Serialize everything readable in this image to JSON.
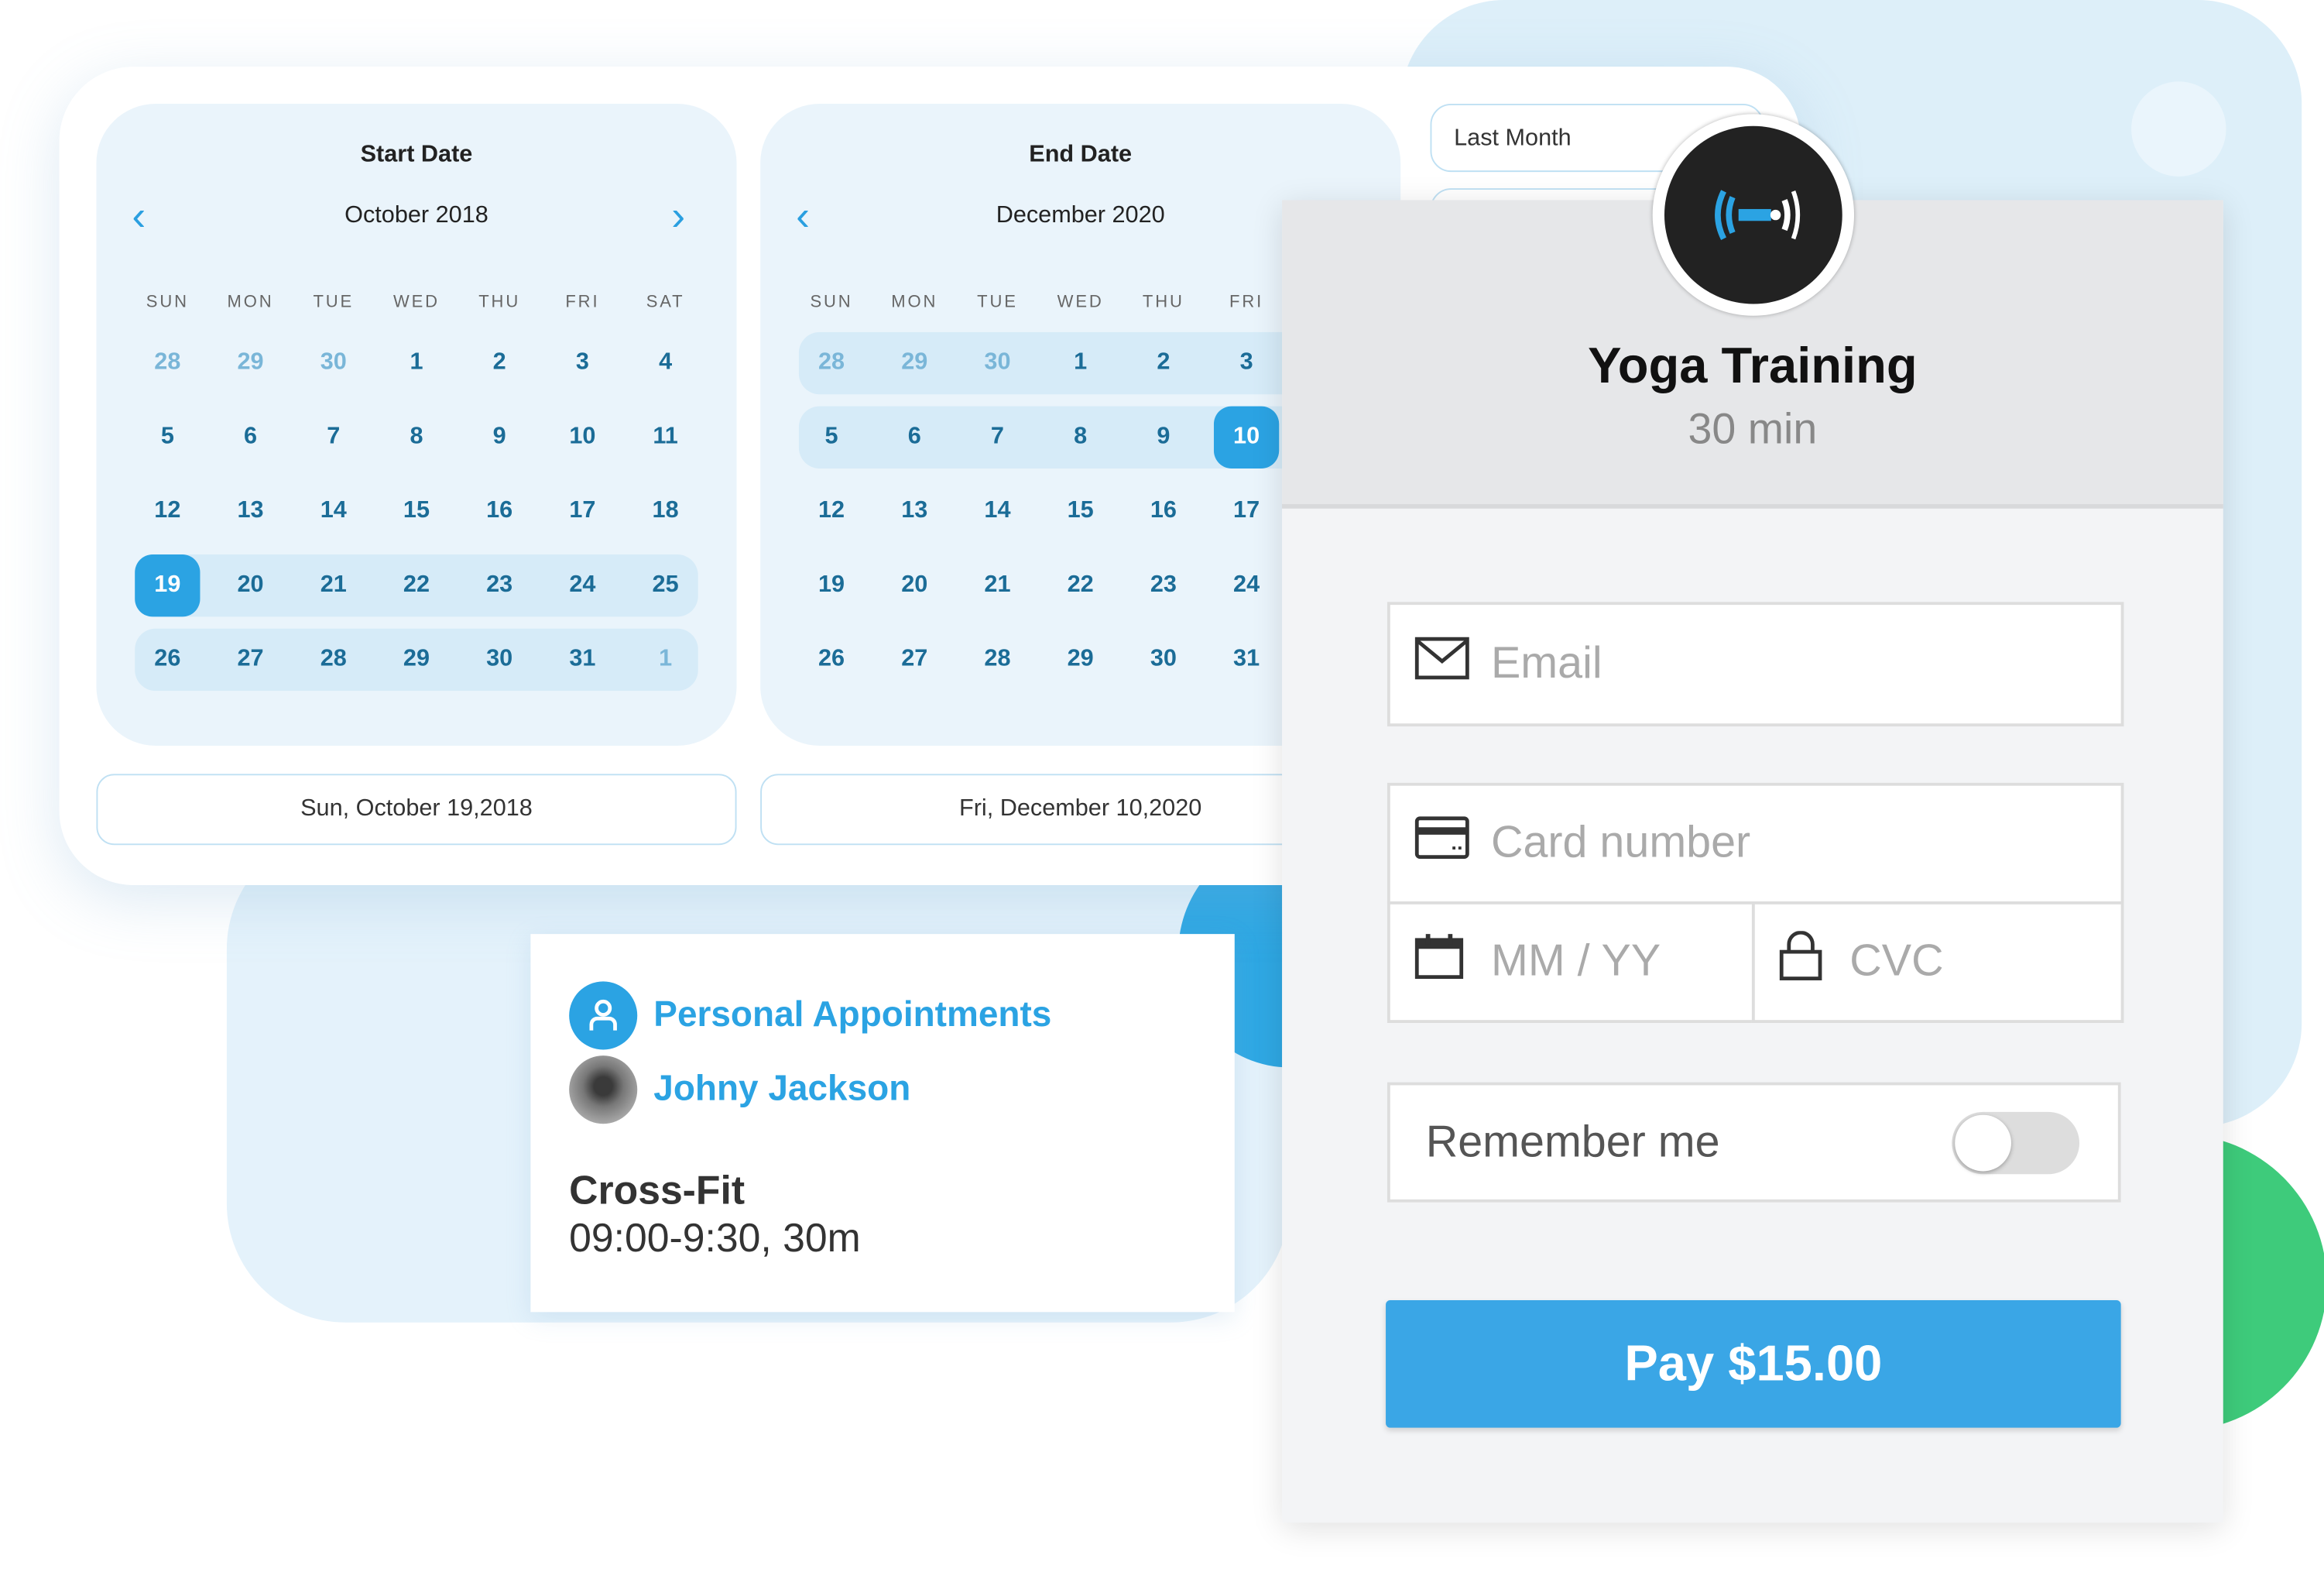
{
  "colors": {
    "accent": "#2ba3e3",
    "pay_button": "#3aa6e6",
    "green": "#3ecb7b",
    "range": "#d6ebf8"
  },
  "weekdays": [
    "SUN",
    "MON",
    "TUE",
    "WED",
    "THU",
    "FRI",
    "SAT"
  ],
  "start_calendar": {
    "title": "Start Date",
    "month": "October 2018",
    "prev_icon": "chevron-left-icon",
    "next_icon": "chevron-right-icon",
    "weeks": [
      [
        "28",
        "29",
        "30",
        "1",
        "2",
        "3",
        "4"
      ],
      [
        "5",
        "6",
        "7",
        "8",
        "9",
        "10",
        "11"
      ],
      [
        "12",
        "13",
        "14",
        "15",
        "16",
        "17",
        "18"
      ],
      [
        "19",
        "20",
        "21",
        "22",
        "23",
        "24",
        "25"
      ],
      [
        "26",
        "27",
        "28",
        "29",
        "30",
        "31",
        "1"
      ]
    ],
    "muted": [
      [
        0,
        0
      ],
      [
        0,
        1
      ],
      [
        0,
        2
      ],
      [
        4,
        6
      ]
    ],
    "selected": [
      3,
      0
    ],
    "range_rows": [
      3,
      4
    ],
    "selected_date": "Sun, October 19,2018"
  },
  "end_calendar": {
    "title": "End Date",
    "month": "December 2020",
    "prev_icon": "chevron-left-icon",
    "weeks": [
      [
        "28",
        "29",
        "30",
        "1",
        "2",
        "3"
      ],
      [
        "5",
        "6",
        "7",
        "8",
        "9",
        "10"
      ],
      [
        "12",
        "13",
        "14",
        "15",
        "16",
        "17"
      ],
      [
        "19",
        "20",
        "21",
        "22",
        "23",
        "24"
      ],
      [
        "26",
        "27",
        "28",
        "29",
        "30",
        "31"
      ]
    ],
    "muted": [
      [
        0,
        0
      ],
      [
        0,
        1
      ],
      [
        0,
        2
      ]
    ],
    "selected": [
      1,
      5
    ],
    "range_rows": [
      0,
      1
    ],
    "selected_date": "Fri, December 10,2020"
  },
  "presets": {
    "last_month": "Last Month"
  },
  "appointment": {
    "category": "Personal Appointments",
    "person": "Johny Jackson",
    "class": "Cross-Fit",
    "time": "09:00-9:30, 30m"
  },
  "payment": {
    "title": "Yoga Training",
    "duration": "30 min",
    "email_placeholder": "Email",
    "card_placeholder": "Card number",
    "expiry_placeholder": "MM / YY",
    "cvc_placeholder": "CVC",
    "remember_label": "Remember me",
    "remember_on": false,
    "pay_label": "Pay $15.00"
  }
}
